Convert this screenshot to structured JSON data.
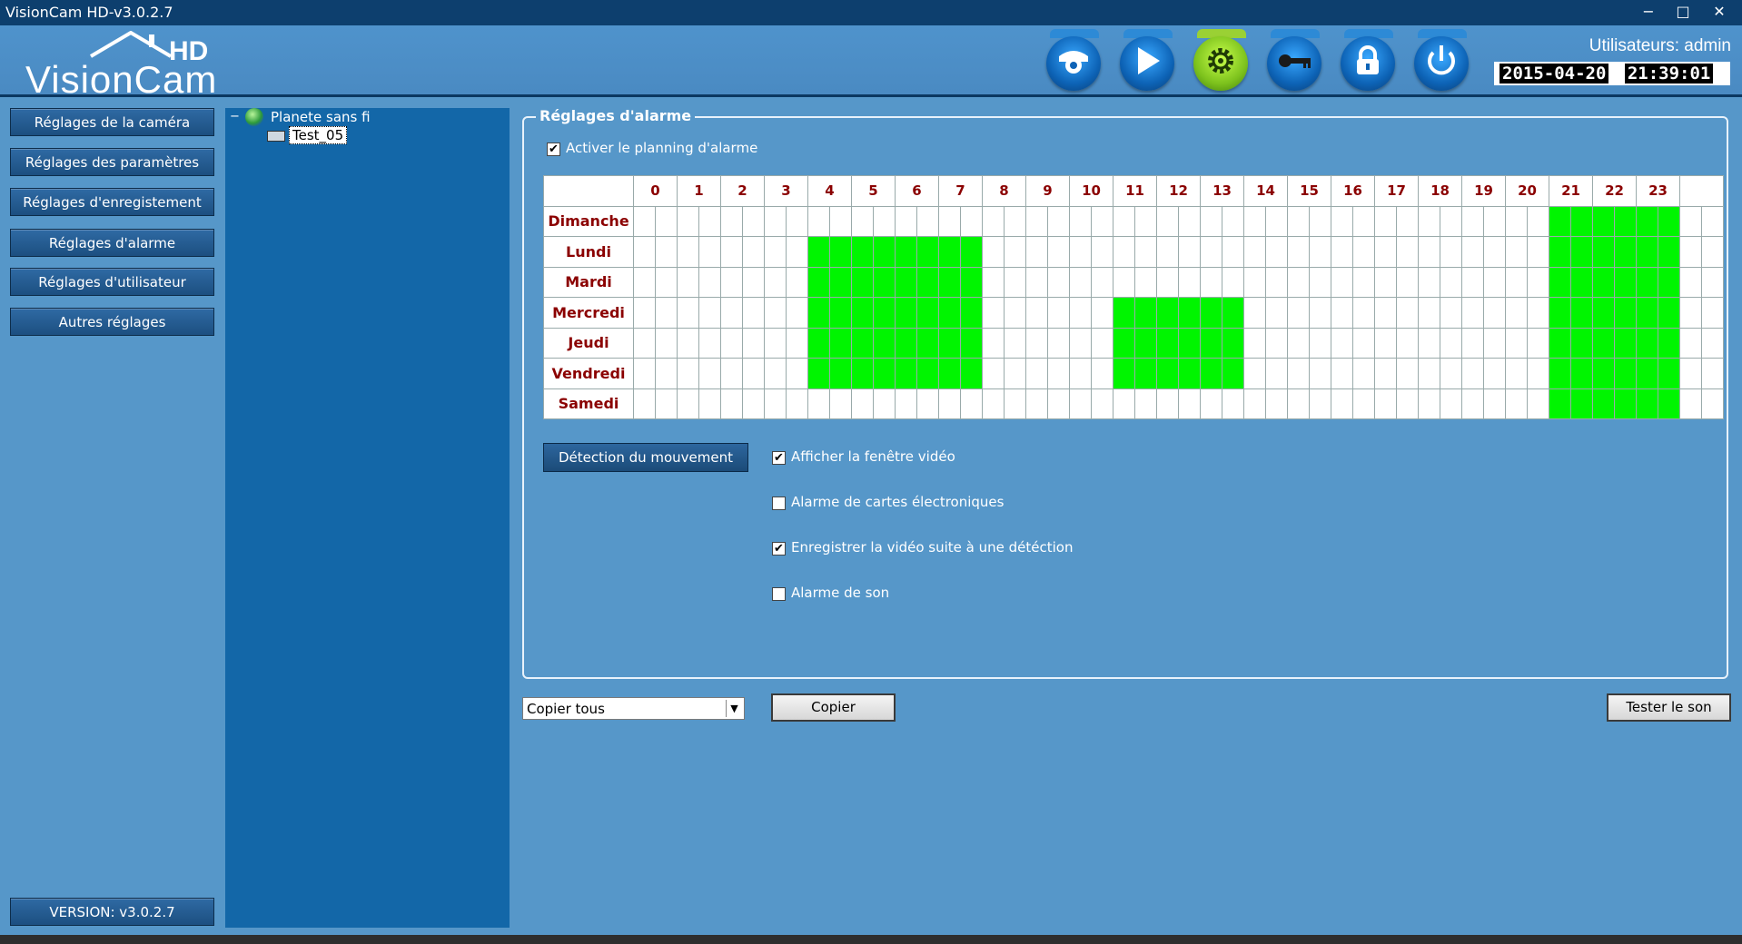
{
  "window": {
    "title": "VisionCam HD-v3.0.2.7",
    "minimize": "−",
    "maximize": "□",
    "close": "✕"
  },
  "header": {
    "logo_hd": "HD",
    "logo_name": "VisionCam",
    "users_label": "Utilisateurs: admin",
    "date": "2015-04-20",
    "time": "21:39:01",
    "toolbar": [
      "camera-view-icon",
      "playback-icon",
      "settings-gear-icon",
      "key-icon",
      "lock-icon",
      "power-icon"
    ],
    "active_tool": "settings-gear-icon",
    "active_color": "#7dc21d"
  },
  "sidebar": {
    "items": [
      {
        "label": "Réglages de la caméra"
      },
      {
        "label": "Réglages des paramètres"
      },
      {
        "label": "Réglages d'enregistement"
      },
      {
        "label": "Réglages d'alarme"
      },
      {
        "label": "Réglages d'utilisateur"
      },
      {
        "label": "Autres réglages"
      }
    ],
    "version": "VERSION: v3.0.2.7"
  },
  "tree": {
    "collapse_symbol": "−",
    "root": "Planete sans fi",
    "child": "Test_05"
  },
  "alarm": {
    "group_title": "Réglages d'alarme",
    "enable_schedule": {
      "label": "Activer le planning d'alarme",
      "checked": true
    },
    "hours": [
      "0",
      "1",
      "2",
      "3",
      "4",
      "5",
      "6",
      "7",
      "8",
      "9",
      "10",
      "11",
      "12",
      "13",
      "14",
      "15",
      "16",
      "17",
      "18",
      "19",
      "20",
      "21",
      "22",
      "23"
    ],
    "days": [
      {
        "name": "Dimanche",
        "active_hours": [
          21,
          22,
          23
        ]
      },
      {
        "name": "Lundi",
        "active_hours": [
          4,
          5,
          6,
          7,
          21,
          22,
          23
        ]
      },
      {
        "name": "Mardi",
        "active_hours": [
          4,
          5,
          6,
          7,
          21,
          22,
          23
        ]
      },
      {
        "name": "Mercredi",
        "active_hours": [
          4,
          5,
          6,
          7,
          11,
          12,
          13,
          21,
          22,
          23
        ]
      },
      {
        "name": "Jeudi",
        "active_hours": [
          4,
          5,
          6,
          7,
          11,
          12,
          13,
          21,
          22,
          23
        ]
      },
      {
        "name": "Vendredi",
        "active_hours": [
          4,
          5,
          6,
          7,
          11,
          12,
          13,
          21,
          22,
          23
        ]
      },
      {
        "name": "Samedi",
        "active_hours": [
          21,
          22,
          23
        ]
      }
    ],
    "active_color": "#00f500",
    "motion_button": "Détection du mouvement",
    "options": [
      {
        "label": "Afficher la fenêtre vidéo",
        "checked": true
      },
      {
        "label": "Alarme de cartes électroniques",
        "checked": false
      },
      {
        "label": "Enregistrer la vidéo suite à une détéction",
        "checked": true
      },
      {
        "label": "Alarme de son",
        "checked": false
      }
    ],
    "copy_select": "Copier tous",
    "copy_button": "Copier",
    "test_sound_button": "Tester le son"
  }
}
